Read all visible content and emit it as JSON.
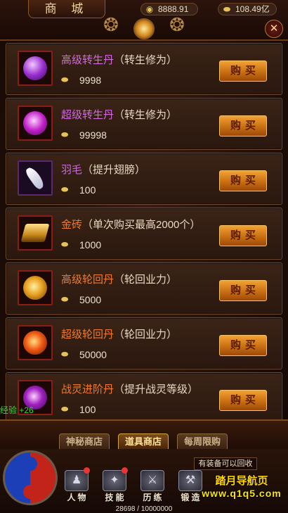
{
  "header": {
    "title": "商 城",
    "currency_silver": "8888.91",
    "currency_gold": "108.49亿",
    "close_glyph": "✕",
    "icons": {
      "silver": "coin-icon",
      "gold": "gold-ingot-icon",
      "close": "close-icon",
      "emblem": "flame-emblem-icon"
    }
  },
  "items": [
    {
      "name": "高级转生丹",
      "desc": "（转生修为）",
      "price": "9998",
      "buy_label": "购买",
      "icon": "purple-orb-icon",
      "name_color": "#d26be0"
    },
    {
      "name": "超级转生丹",
      "desc": "（转生修为）",
      "price": "99998",
      "buy_label": "购买",
      "icon": "magenta-orb-icon",
      "name_color": "#d26be0"
    },
    {
      "name": "羽毛",
      "desc": "（提升翅膀）",
      "price": "100",
      "buy_label": "购买",
      "icon": "feather-icon",
      "name_color": "#c86ad8"
    },
    {
      "name": "金砖",
      "desc": "（单次购买最高2000个）",
      "price": "1000",
      "buy_label": "购买",
      "icon": "gold-brick-icon",
      "name_color": "#ef7a2c"
    },
    {
      "name": "高级轮回丹",
      "desc": "（轮回业力）",
      "price": "5000",
      "buy_label": "购买",
      "icon": "gold-swirl-orb-icon",
      "name_color": "#ef7a2c"
    },
    {
      "name": "超级轮回丹",
      "desc": "（轮回业力）",
      "price": "50000",
      "buy_label": "购买",
      "icon": "fire-swirl-orb-icon",
      "name_color": "#ef7a2c"
    },
    {
      "name": "战灵进阶丹",
      "desc": "（提升战灵等级）",
      "price": "100",
      "buy_label": "购买",
      "icon": "violet-orb-icon",
      "name_color": "#ef7a2c"
    }
  ],
  "exp_text": "经验 +26",
  "tabs": [
    {
      "label": "神秘商店",
      "active": false
    },
    {
      "label": "道具商店",
      "active": true
    },
    {
      "label": "每周限购",
      "active": false
    }
  ],
  "hud": {
    "nav": [
      {
        "label": "人物",
        "icon": "character-icon"
      },
      {
        "label": "技能",
        "icon": "skill-book-icon"
      },
      {
        "label": "历练",
        "icon": "training-icon"
      },
      {
        "label": "锻造",
        "icon": "forge-anvil-icon"
      }
    ],
    "tooltip": "有装备可以回收",
    "xp": "28698 / 10000000",
    "watermark_line1": "踏月导航页",
    "watermark_line2": "www.q1q5.com"
  }
}
